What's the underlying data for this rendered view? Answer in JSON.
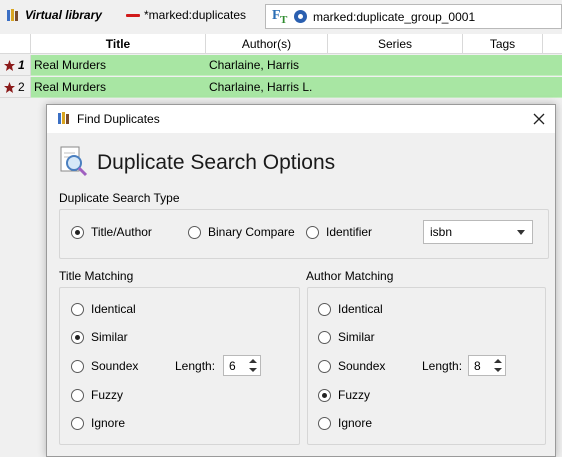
{
  "toolbar": {
    "virtual_library_label": "Virtual library",
    "saved_search_label": "*marked:duplicates",
    "search_text": "marked:duplicate_group_0001"
  },
  "table": {
    "columns": [
      "Title",
      "Author(s)",
      "Series",
      "Tags"
    ],
    "rows": [
      {
        "num": "1",
        "title": "Real Murders",
        "author": "Charlaine, Harris"
      },
      {
        "num": "2",
        "title": "Real Murders",
        "author": "Charlaine, Harris L."
      }
    ]
  },
  "dialog": {
    "window_title": "Find Duplicates",
    "heading": "Duplicate Search Options",
    "search_type": {
      "label": "Duplicate Search Type",
      "options": [
        "Title/Author",
        "Binary Compare",
        "Identifier"
      ],
      "selected": "Title/Author",
      "identifier_value": "isbn"
    },
    "title_matching": {
      "label": "Title Matching",
      "options": [
        "Identical",
        "Similar",
        "Soundex",
        "Fuzzy",
        "Ignore"
      ],
      "selected": "Similar",
      "length_label": "Length:",
      "length_value": "6"
    },
    "author_matching": {
      "label": "Author Matching",
      "options": [
        "Identical",
        "Similar",
        "Soundex",
        "Fuzzy",
        "Ignore"
      ],
      "selected": "Fuzzy",
      "length_label": "Length:",
      "length_value": "8"
    }
  },
  "colors": {
    "row_highlight": "#a8e6a3",
    "marked_indicator": "#d11a1a",
    "accent_blue": "#2a6db5"
  }
}
